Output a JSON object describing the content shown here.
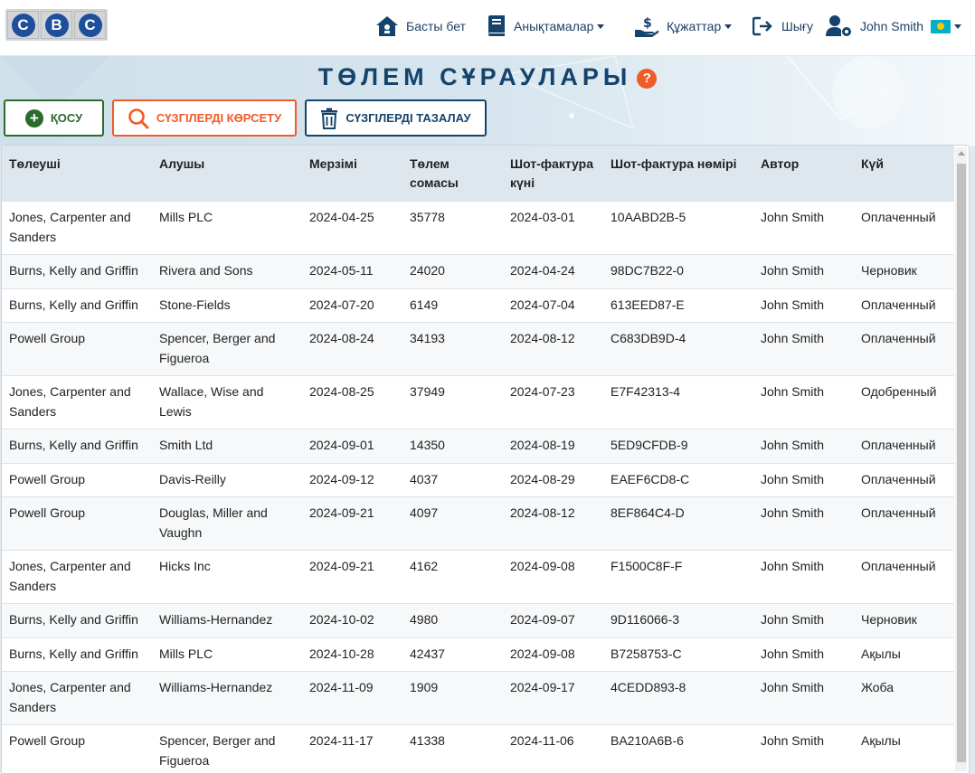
{
  "brand": {
    "letters": [
      "C",
      "B",
      "C"
    ]
  },
  "nav": {
    "home": "Басты бет",
    "references": "Анықтамалар",
    "documents": "Құжаттар",
    "logout": "Шығу",
    "user": "John Smith"
  },
  "page": {
    "title": "ТӨЛЕМ СҰРАУЛАРЫ",
    "help": "?"
  },
  "actions": {
    "add": "ҚОСУ",
    "show_filters": "СҮЗГІЛЕРДІ КӨРСЕТУ",
    "clear_filters": "СҮЗГІЛЕРДІ ТАЗАЛАУ"
  },
  "table": {
    "columns": [
      "Төлеуші",
      "Алушы",
      "Мерзімі",
      "Төлем сомасы",
      "Шот-фактура күні",
      "Шот-фактура нөмірі",
      "Автор",
      "Күй"
    ],
    "rows": [
      [
        "Jones, Carpenter and Sanders",
        "Mills PLC",
        "2024-04-25",
        "35778",
        "2024-03-01",
        "10AABD2B-5",
        "John Smith",
        "Оплаченный"
      ],
      [
        "Burns, Kelly and Griffin",
        "Rivera and Sons",
        "2024-05-11",
        "24020",
        "2024-04-24",
        "98DC7B22-0",
        "John Smith",
        "Черновик"
      ],
      [
        "Burns, Kelly and Griffin",
        "Stone-Fields",
        "2024-07-20",
        "6149",
        "2024-07-04",
        "613EED87-E",
        "John Smith",
        "Оплаченный"
      ],
      [
        "Powell Group",
        "Spencer, Berger and Figueroa",
        "2024-08-24",
        "34193",
        "2024-08-12",
        "C683DB9D-4",
        "John Smith",
        "Оплаченный"
      ],
      [
        "Jones, Carpenter and Sanders",
        "Wallace, Wise and Lewis",
        "2024-08-25",
        "37949",
        "2024-07-23",
        "E7F42313-4",
        "John Smith",
        "Одобренный"
      ],
      [
        "Burns, Kelly and Griffin",
        "Smith Ltd",
        "2024-09-01",
        "14350",
        "2024-08-19",
        "5ED9CFDB-9",
        "John Smith",
        "Оплаченный"
      ],
      [
        "Powell Group",
        "Davis-Reilly",
        "2024-09-12",
        "4037",
        "2024-08-29",
        "EAEF6CD8-C",
        "John Smith",
        "Оплаченный"
      ],
      [
        "Powell Group",
        "Douglas, Miller and Vaughn",
        "2024-09-21",
        "4097",
        "2024-08-12",
        "8EF864C4-D",
        "John Smith",
        "Оплаченный"
      ],
      [
        "Jones, Carpenter and Sanders",
        "Hicks Inc",
        "2024-09-21",
        "4162",
        "2024-09-08",
        "F1500C8F-F",
        "John Smith",
        "Оплаченный"
      ],
      [
        "Burns, Kelly and Griffin",
        "Williams-Hernandez",
        "2024-10-02",
        "4980",
        "2024-09-07",
        "9D116066-3",
        "John Smith",
        "Черновик"
      ],
      [
        "Burns, Kelly and Griffin",
        "Mills PLC",
        "2024-10-28",
        "42437",
        "2024-09-08",
        "B7258753-C",
        "John Smith",
        "Ақылы"
      ],
      [
        "Jones, Carpenter and Sanders",
        "Williams-Hernandez",
        "2024-11-09",
        "1909",
        "2024-09-17",
        "4CEDD893-8",
        "John Smith",
        "Жоба"
      ],
      [
        "Powell Group",
        "Spencer, Berger and Figueroa",
        "2024-11-17",
        "41338",
        "2024-11-06",
        "BA210A6B-6",
        "John Smith",
        "Ақылы"
      ]
    ]
  },
  "colors": {
    "primary": "#15436b",
    "accent": "#f15a29",
    "success": "#2b6b2b",
    "header_bg": "#dfe7ee"
  }
}
